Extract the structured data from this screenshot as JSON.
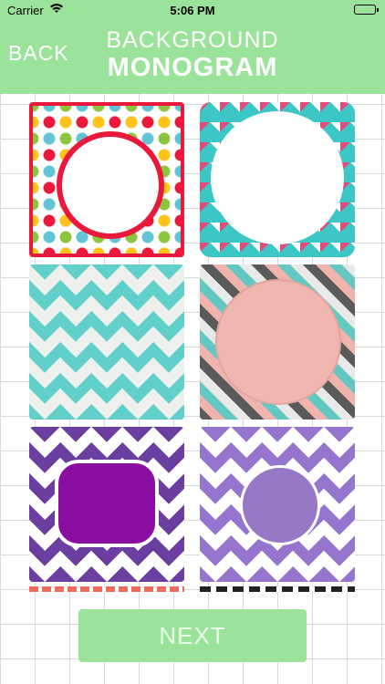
{
  "status_bar": {
    "carrier": "Carrier",
    "time": "5:06 PM"
  },
  "header": {
    "back_label": "BACK",
    "title_line1": "BACKGROUND",
    "title_line2": "MONOGRAM"
  },
  "footer": {
    "next_label": "NEXT"
  },
  "tiles": [
    {
      "id": "polka-dots",
      "colors": [
        "#e8193a",
        "#ffc21a",
        "#62c3d6",
        "#8cc63f"
      ],
      "selected": true
    },
    {
      "id": "teal-triangles",
      "colors": [
        "#3cc6c6",
        "#e24b7a",
        "#ffffff"
      ]
    },
    {
      "id": "teal-chevron",
      "colors": [
        "#61d0cb",
        "#eef0ee"
      ]
    },
    {
      "id": "tribal-pink-circle",
      "colors": [
        "#f2b6b0",
        "#5a5a5a",
        "#63c8c1"
      ]
    },
    {
      "id": "purple-chevron-label",
      "colors": [
        "#6b3fa0",
        "#8a0ea2"
      ]
    },
    {
      "id": "lavender-chevron-circle",
      "colors": [
        "#9575cd",
        "#9678c7"
      ]
    }
  ]
}
